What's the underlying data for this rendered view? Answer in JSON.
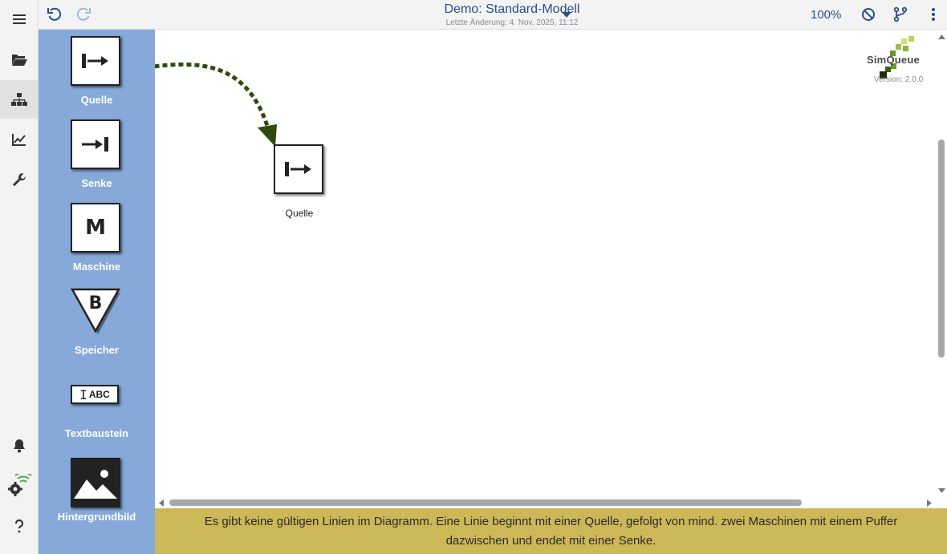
{
  "app": {
    "title": "Demo: Standard-Modell",
    "last_change": "Letzte Änderung: 4. Nov. 2025, 11:12",
    "zoom": "100%",
    "version": "Version: 2.0.0",
    "logo_text": "SimQueue"
  },
  "rail": {
    "items": [
      {
        "icon": "menu-icon"
      },
      {
        "icon": "folder-open-icon"
      },
      {
        "icon": "sitemap-icon",
        "active": true
      },
      {
        "icon": "chart-line-icon"
      },
      {
        "icon": "wrench-icon"
      },
      {
        "icon": "bell-icon"
      },
      {
        "icon": "gear-wifi-icon"
      },
      {
        "icon": "question-icon"
      }
    ]
  },
  "header": {
    "buttons": [
      "undo-icon",
      "redo-icon",
      "chevron-down-icon",
      "block-icon",
      "branch-icon",
      "more-vertical-icon"
    ]
  },
  "palette": {
    "items": [
      {
        "label": "Quelle",
        "icon": "source-icon"
      },
      {
        "label": "Senke",
        "icon": "sink-icon"
      },
      {
        "label": "Maschine",
        "icon": "machine-icon",
        "glyph": "M"
      },
      {
        "label": "Speicher",
        "icon": "buffer-icon",
        "glyph": "B"
      },
      {
        "label": "Textbaustein",
        "icon": "text-icon",
        "glyph": "ABC"
      },
      {
        "label": "Hintergrundbild",
        "icon": "image-icon"
      }
    ]
  },
  "canvas": {
    "nodes": [
      {
        "label": "Quelle",
        "type": "source"
      }
    ]
  },
  "colors": {
    "palette_bg": "#86a9d9",
    "accent": "#2b4c8e",
    "status_bg": "#cdb858",
    "edge": "#2e4a0e"
  },
  "status": {
    "message": "Es gibt keine gültigen Linien im Diagramm. Eine Linie beginnt mit einer Quelle, gefolgt von mind. zwei Maschinen mit einem Puffer dazwischen und endet mit einer Senke."
  }
}
